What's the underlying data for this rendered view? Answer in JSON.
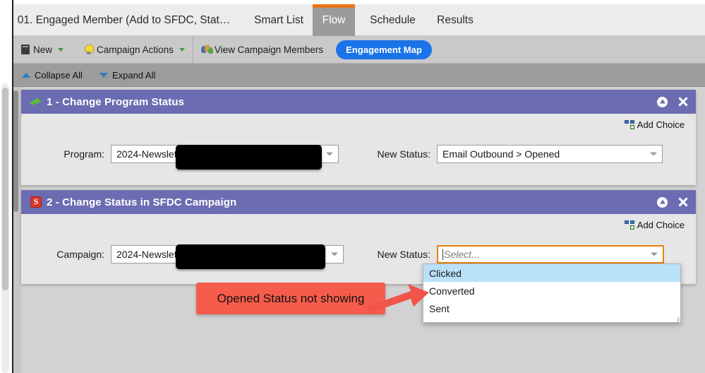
{
  "tabs": [
    {
      "label": "01. Engaged Member (Add to SFDC, Stat…",
      "active": false
    },
    {
      "label": "Smart List",
      "active": false
    },
    {
      "label": "Flow",
      "active": true
    },
    {
      "label": "Schedule",
      "active": false
    },
    {
      "label": "Results",
      "active": false
    }
  ],
  "toolbar": {
    "new_label": "New",
    "new_icon": "new-document-icon",
    "campaign_actions_label": "Campaign Actions",
    "campaign_actions_icon": "lightbulb-icon",
    "view_members_label": "View Campaign Members",
    "view_members_icon": "people-icon",
    "engagement_map_label": "Engagement Map"
  },
  "tree_bar": {
    "collapse_label": "Collapse All",
    "collapse_icon": "triangle-up-icon",
    "expand_label": "Expand All",
    "expand_icon": "triangle-down-icon"
  },
  "steps": [
    {
      "title": "1 - Change Program Status",
      "icon": "green-arrow-icon",
      "add_choice_label": "Add Choice",
      "add_choice_icon": "add-choice-icon",
      "left_field": {
        "label": "Program:",
        "value": "2024-Newsletter",
        "redacted": true
      },
      "right_field": {
        "label": "New Status:",
        "value": "Email Outbound > Opened"
      },
      "header_icons": [
        "up-circle-icon",
        "close-icon"
      ]
    },
    {
      "title": "2 - Change Status in SFDC Campaign",
      "icon": "salesforce-icon",
      "add_choice_label": "Add Choice",
      "add_choice_icon": "add-choice-icon",
      "left_field": {
        "label": "Campaign:",
        "value": "2024-Newsletter",
        "redacted": true
      },
      "right_field": {
        "label": "New Status:",
        "placeholder": "Select...",
        "value": ""
      },
      "header_icons": [
        "up-circle-icon",
        "close-icon"
      ]
    }
  ],
  "dropdown": {
    "options": [
      "Clicked",
      "Converted",
      "Sent"
    ],
    "selected_index": 0
  },
  "annotation": {
    "text": "Opened Status not showing",
    "color": "#f65c4b",
    "arrow_icon": "arrow-right-icon"
  },
  "colors": {
    "panel_header": "#6c6cb2",
    "active_tab_accent": "#e8761a",
    "primary_button": "#1a73e8",
    "focus_border": "#e8820c",
    "option_highlight": "#b9e1f7",
    "annotation": "#f65c4b"
  }
}
